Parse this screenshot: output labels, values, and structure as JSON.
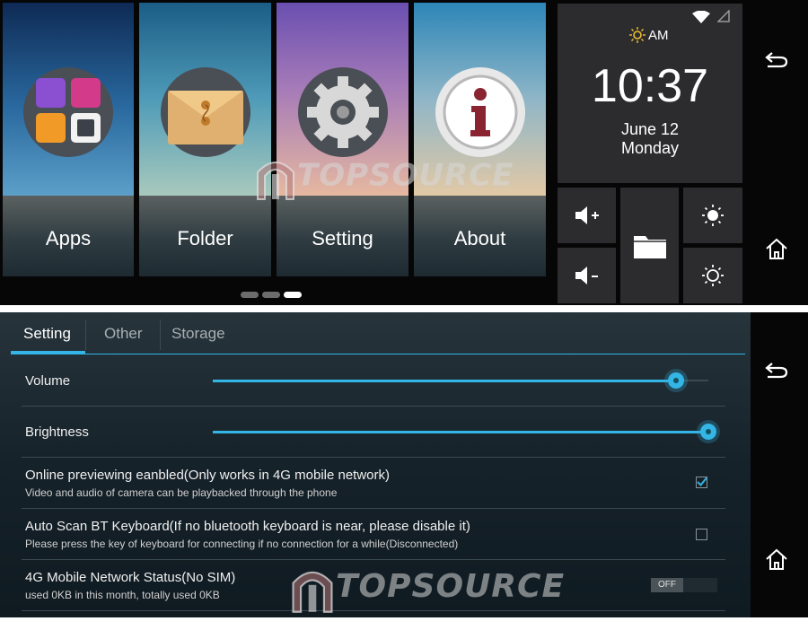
{
  "launcher": {
    "tiles": [
      {
        "label": "Apps",
        "icon": "apps-grid-icon"
      },
      {
        "label": "Folder",
        "icon": "envelope-folder-icon"
      },
      {
        "label": "Setting",
        "icon": "gear-icon"
      },
      {
        "label": "About",
        "icon": "info-icon"
      }
    ],
    "page_count": 3,
    "active_page": 3
  },
  "clock": {
    "ampm": "AM",
    "time": "10:37",
    "date": "June 12",
    "weekday": "Monday"
  },
  "quick_controls": [
    "volume-up-icon",
    "volume-down-icon",
    "folder-icon",
    "brightness-up-icon",
    "brightness-down-icon"
  ],
  "watermark": "TOPSOURCE",
  "settings": {
    "tabs": [
      {
        "label": "Setting",
        "active": true
      },
      {
        "label": "Other",
        "active": false
      },
      {
        "label": "Storage",
        "active": false
      }
    ],
    "volume": {
      "label": "Volume",
      "level": 0.93
    },
    "brightness": {
      "label": "Brightness",
      "level": 1.0
    },
    "online_preview": {
      "title": "Online previewing eanbled(Only works in 4G mobile network)",
      "subtitle": "Video and audio of camera can be playbacked through the phone",
      "checked": true
    },
    "bt_keyboard": {
      "title": "Auto Scan BT Keyboard(If no bluetooth keyboard is near, please disable it)",
      "subtitle": "Please press the key of keyboard for connecting if no connection for a while(Disconnected)",
      "checked": false
    },
    "mobile_network": {
      "title": "4G Mobile Network Status(No SIM)",
      "subtitle": "used 0KB in this month, totally used 0KB",
      "toggle": "OFF"
    }
  },
  "colors": {
    "accent": "#33b5e5",
    "panel": "#2c2c2e"
  }
}
